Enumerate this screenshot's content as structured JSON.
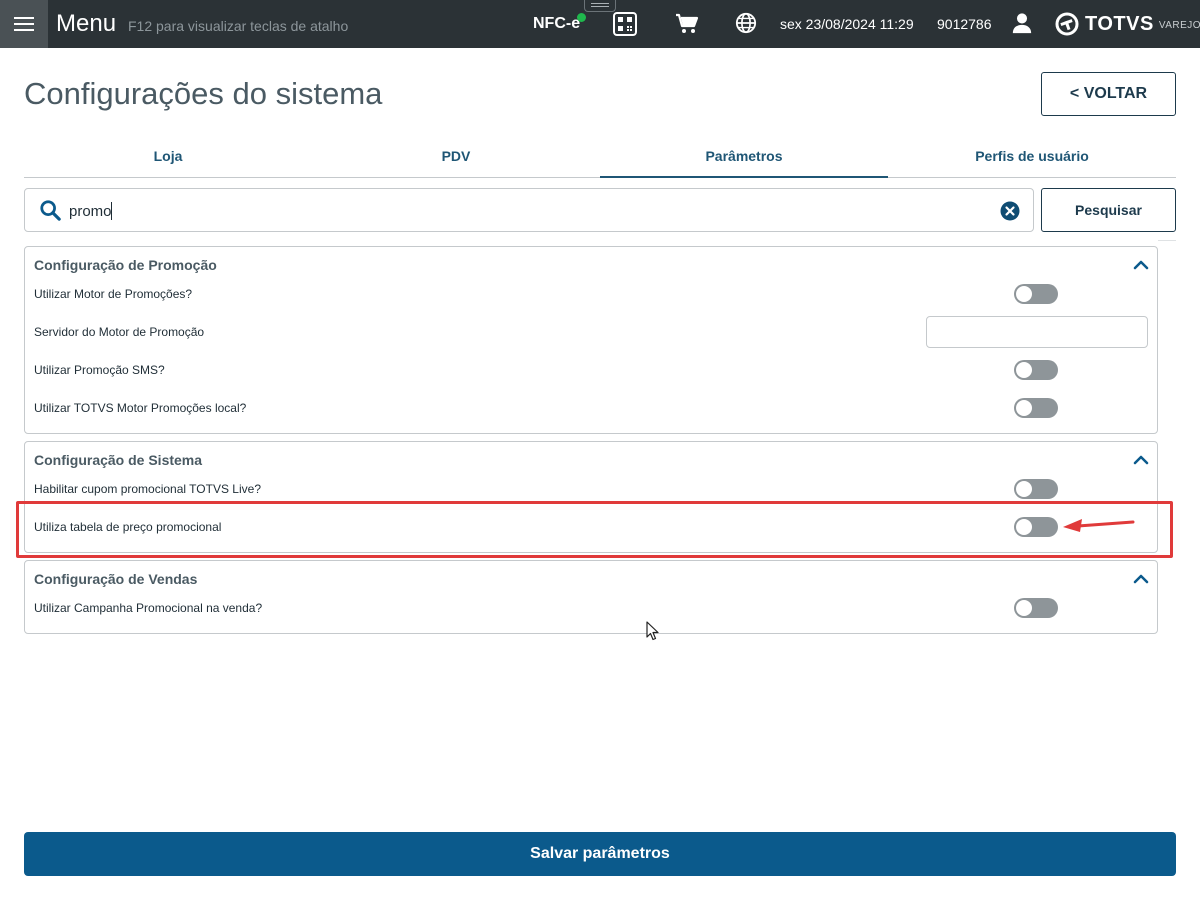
{
  "topbar": {
    "menu_label": "Menu",
    "shortcut_hint": "F12 para visualizar teclas de atalho",
    "document_type": "NFC-e",
    "datetime": "sex 23/08/2024 11:29",
    "user_id": "9012786",
    "brand": "TOTVS",
    "brand_sub": "VAREJO",
    "status_color": "#1fb84d",
    "icons": [
      "hamburger-menu-icon",
      "qr-code-icon",
      "cart-icon",
      "globe-icon",
      "user-icon",
      "totvs-logo-icon"
    ]
  },
  "page": {
    "title": "Configurações do sistema",
    "back_label": "<  VOLTAR"
  },
  "tabs": [
    {
      "label": "Loja",
      "active": false
    },
    {
      "label": "PDV",
      "active": false
    },
    {
      "label": "Parâmetros",
      "active": true
    },
    {
      "label": "Perfis de usuário",
      "active": false
    }
  ],
  "search": {
    "value": "promo",
    "button_label": "Pesquisar"
  },
  "sections": [
    {
      "title": "Configuração de Promoção",
      "rows": [
        {
          "label": "Utilizar Motor de Promoções?",
          "control": "toggle",
          "on": false
        },
        {
          "label": "Servidor do Motor de Promoção",
          "control": "text",
          "value": ""
        },
        {
          "label": "Utilizar Promoção SMS?",
          "control": "toggle",
          "on": false
        },
        {
          "label": "Utilizar TOTVS Motor Promoções local?",
          "control": "toggle",
          "on": false
        }
      ]
    },
    {
      "title": "Configuração de Sistema",
      "rows": [
        {
          "label": "Habilitar cupom promocional TOTVS Live?",
          "control": "toggle",
          "on": false
        },
        {
          "label": "Utiliza tabela de preço promocional",
          "control": "toggle",
          "on": false
        }
      ]
    },
    {
      "title": "Configuração de Vendas",
      "rows": [
        {
          "label": "Utilizar Campanha Promocional na venda?",
          "control": "toggle",
          "on": false
        }
      ]
    }
  ],
  "save_label": "Salvar parâmetros",
  "colors": {
    "topbar": "#2b3236",
    "primary": "#0b5a8c",
    "tab_text": "#1f5675",
    "highlight": "#e03a3a",
    "toggle_off": "#8e9599"
  }
}
